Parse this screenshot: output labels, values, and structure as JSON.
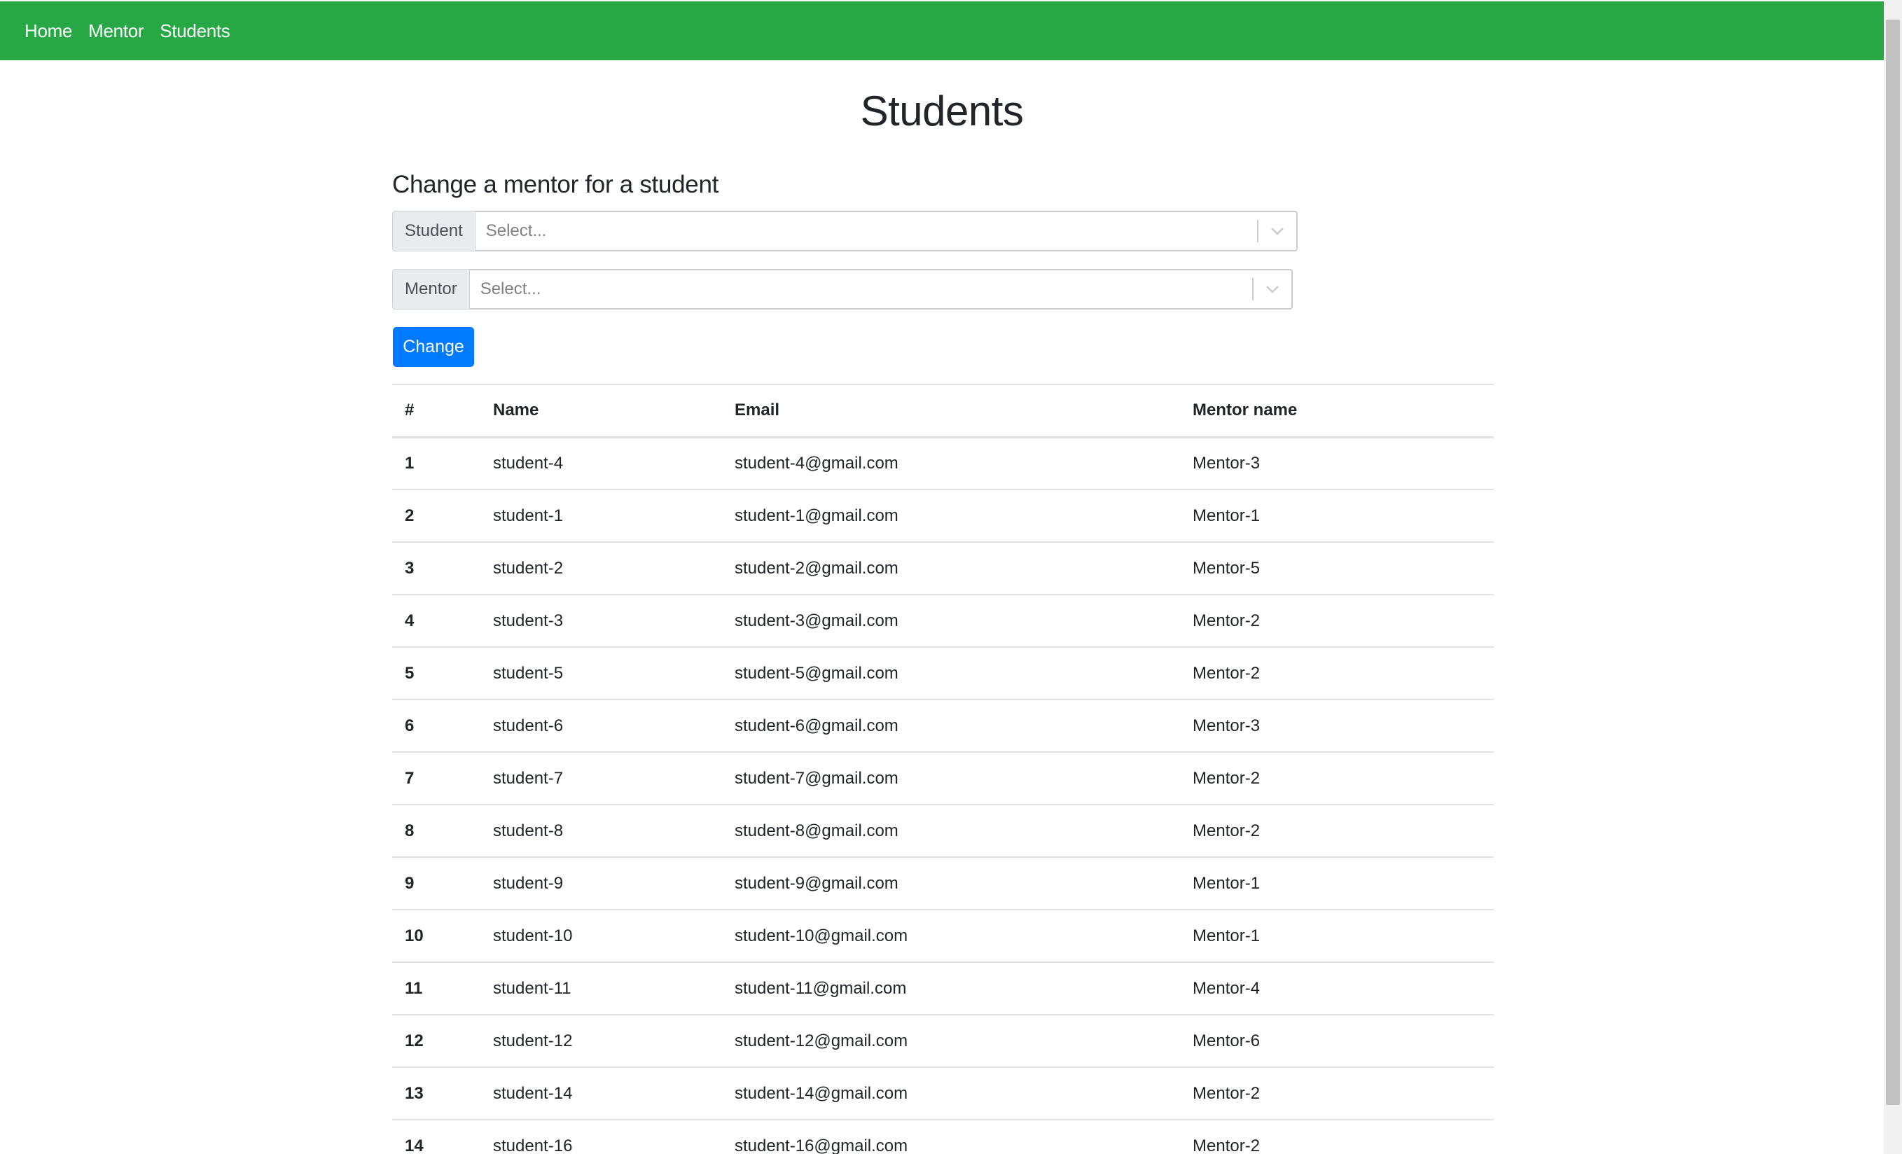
{
  "nav": {
    "links": [
      "Home",
      "Mentor",
      "Students"
    ]
  },
  "page_title": "Students",
  "form": {
    "heading": "Change a mentor for a student",
    "student_label": "Student",
    "student_placeholder": "Select...",
    "mentor_label": "Mentor",
    "mentor_placeholder": "Select...",
    "change_button": "Change"
  },
  "table": {
    "headers": [
      "#",
      "Name",
      "Email",
      "Mentor name"
    ],
    "rows": [
      [
        "1",
        "student-4",
        "student-4@gmail.com",
        "Mentor-3"
      ],
      [
        "2",
        "student-1",
        "student-1@gmail.com",
        "Mentor-1"
      ],
      [
        "3",
        "student-2",
        "student-2@gmail.com",
        "Mentor-5"
      ],
      [
        "4",
        "student-3",
        "student-3@gmail.com",
        "Mentor-2"
      ],
      [
        "5",
        "student-5",
        "student-5@gmail.com",
        "Mentor-2"
      ],
      [
        "6",
        "student-6",
        "student-6@gmail.com",
        "Mentor-3"
      ],
      [
        "7",
        "student-7",
        "student-7@gmail.com",
        "Mentor-2"
      ],
      [
        "8",
        "student-8",
        "student-8@gmail.com",
        "Mentor-2"
      ],
      [
        "9",
        "student-9",
        "student-9@gmail.com",
        "Mentor-1"
      ],
      [
        "10",
        "student-10",
        "student-10@gmail.com",
        "Mentor-1"
      ],
      [
        "11",
        "student-11",
        "student-11@gmail.com",
        "Mentor-4"
      ],
      [
        "12",
        "student-12",
        "student-12@gmail.com",
        "Mentor-6"
      ],
      [
        "13",
        "student-14",
        "student-14@gmail.com",
        "Mentor-2"
      ],
      [
        "14",
        "student-16",
        "student-16@gmail.com",
        "Mentor-2"
      ]
    ]
  },
  "colors": {
    "navbar": "#28a745",
    "primary_button": "#007bff"
  }
}
